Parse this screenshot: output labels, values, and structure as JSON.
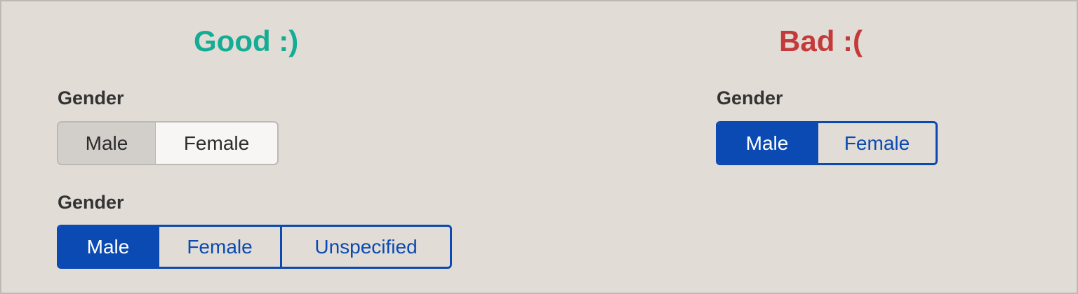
{
  "colors": {
    "good_heading": "#14ad94",
    "bad_heading": "#c43a3a",
    "accent_blue": "#0a4ab2",
    "background": "#e1dcd6"
  },
  "good": {
    "heading": "Good :)",
    "native_control": {
      "label": "Gender",
      "options": [
        "Male",
        "Female"
      ],
      "selected": "Male"
    },
    "toggle_control": {
      "label": "Gender",
      "options": [
        "Male",
        "Female",
        "Unspecified"
      ],
      "selected": "Male"
    }
  },
  "bad": {
    "heading": "Bad :(",
    "toggle_control": {
      "label": "Gender",
      "options": [
        "Male",
        "Female"
      ],
      "selected": "Male"
    }
  }
}
